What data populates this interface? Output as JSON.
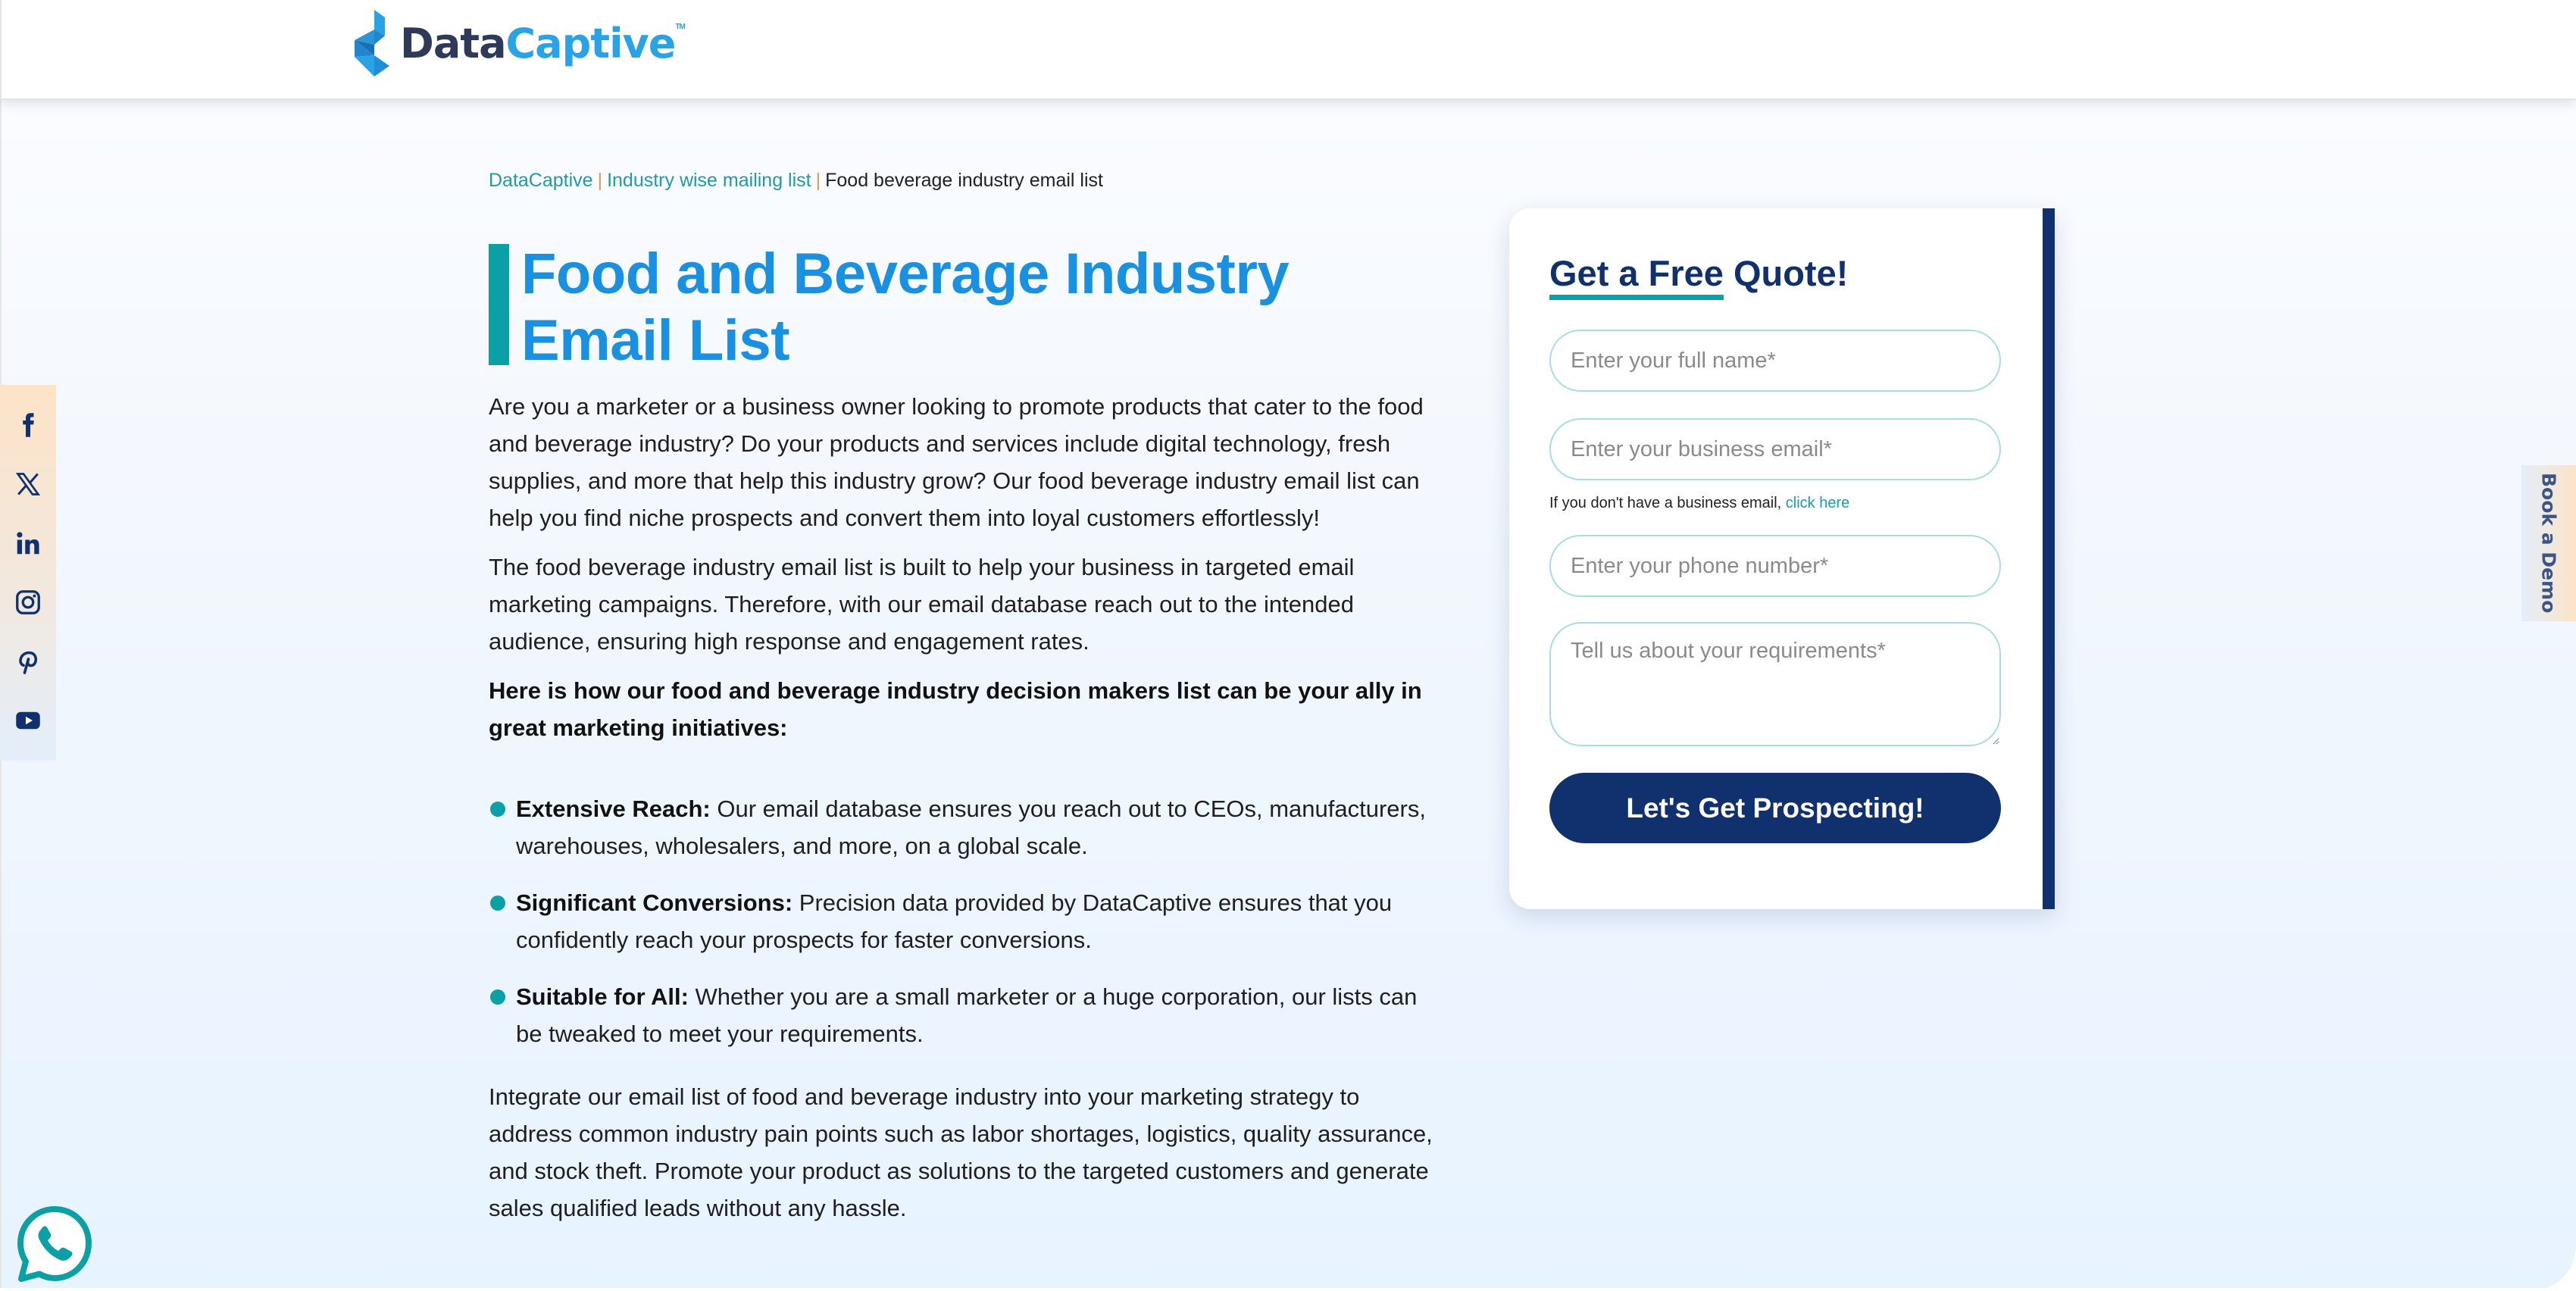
{
  "header": {
    "logo": {
      "part1": "Data",
      "part2": "Captive",
      "trademark": "TM"
    }
  },
  "breadcrumb": [
    {
      "label": "DataCaptive"
    },
    {
      "label": "Industry wise mailing list"
    },
    {
      "label": "Food beverage industry email list"
    }
  ],
  "breadcrumb_separator": "|",
  "page": {
    "title": "Food and Beverage Industry Email List",
    "paragraphs": [
      "Are you a marketer or a business owner looking to promote products that cater to the food and beverage industry? Do your products and services include digital technology, fresh supplies, and more that help this industry grow? Our food beverage industry email list can help you find niche prospects and convert them into loyal customers effortlessly!",
      "The food beverage industry email list is built to help your business in targeted email marketing campaigns. Therefore, with our email database reach out to the intended audience, ensuring high response and engagement rates."
    ],
    "lead_bold": "Here is how our food and beverage industry decision makers list can be your ally in great marketing initiatives:",
    "bullets": [
      {
        "label": "Extensive Reach:",
        "text": " Our email database ensures you reach out to CEOs, manufacturers, warehouses, wholesalers, and more, on a global scale."
      },
      {
        "label": "Significant Conversions:",
        "text": " Precision data provided by DataCaptive ensures that you confidently reach your prospects for faster conversions."
      },
      {
        "label": "Suitable for All:",
        "text": " Whether you are a small marketer or a huge corporation, our lists can be tweaked to meet your requirements."
      }
    ],
    "closing": "Integrate our email list of food and beverage industry into your marketing strategy to address common industry pain points such as labor shortages, logistics, quality assurance, and stock theft. Promote your product as solutions to the targeted customers and generate sales qualified leads without any hassle."
  },
  "form": {
    "title_underlined": "Get a Free",
    "title_rest": " Quote!",
    "full_name_placeholder": "Enter your full name*",
    "email_placeholder": "Enter your business email*",
    "hint_text": "If you don't have a business email, ",
    "hint_link": "click here",
    "phone_placeholder": "Enter your phone number*",
    "requirements_placeholder": "Tell us about your requirements*",
    "submit_label": "Let's Get Prospecting!"
  },
  "social": [
    "facebook",
    "x",
    "linkedin",
    "instagram",
    "pinterest",
    "youtube"
  ],
  "book_demo": {
    "label": "Book a Demo"
  },
  "colors": {
    "brand_navy": "#10306e",
    "accent_teal": "#0aa0a6",
    "title_blue": "#1a90e0",
    "logo_blue": "#2aa3e6"
  }
}
